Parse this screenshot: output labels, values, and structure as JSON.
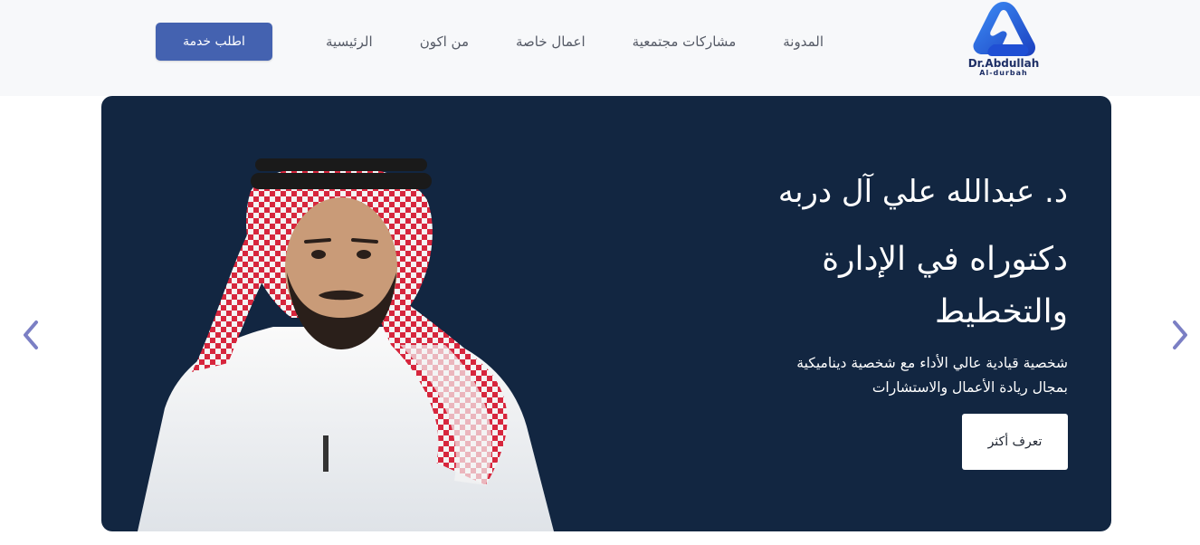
{
  "header": {
    "logo": {
      "name": "Dr.Abdullah",
      "sub": "Al-durbah"
    },
    "nav": [
      {
        "id": "home",
        "label": "الرئيسية"
      },
      {
        "id": "about",
        "label": "من اكون"
      },
      {
        "id": "private-works",
        "label": "اعمال خاصة"
      },
      {
        "id": "community",
        "label": "مشاركات مجتمعية"
      },
      {
        "id": "blog",
        "label": "المدونة"
      }
    ],
    "cta_label": "اطلب خدمة"
  },
  "hero": {
    "title": "د. عبدالله علي آل دربه",
    "subtitle_line1": "دكتوراه في الإدارة",
    "subtitle_line2": "والتخطيط",
    "desc_line1": "شخصية قيادية عالي الأداء مع شخصية ديناميكية",
    "desc_line2": "بمجال ريادة الأعمال والاستشارات",
    "button_label": "تعرف أكثر"
  },
  "colors": {
    "hero_bg": "#122641",
    "accent": "#4462b0",
    "arrow": "#7b7fc4",
    "header_bg": "#f7f8fa"
  },
  "icons": {
    "prev": "chevron-left-icon",
    "next": "chevron-right-icon"
  }
}
